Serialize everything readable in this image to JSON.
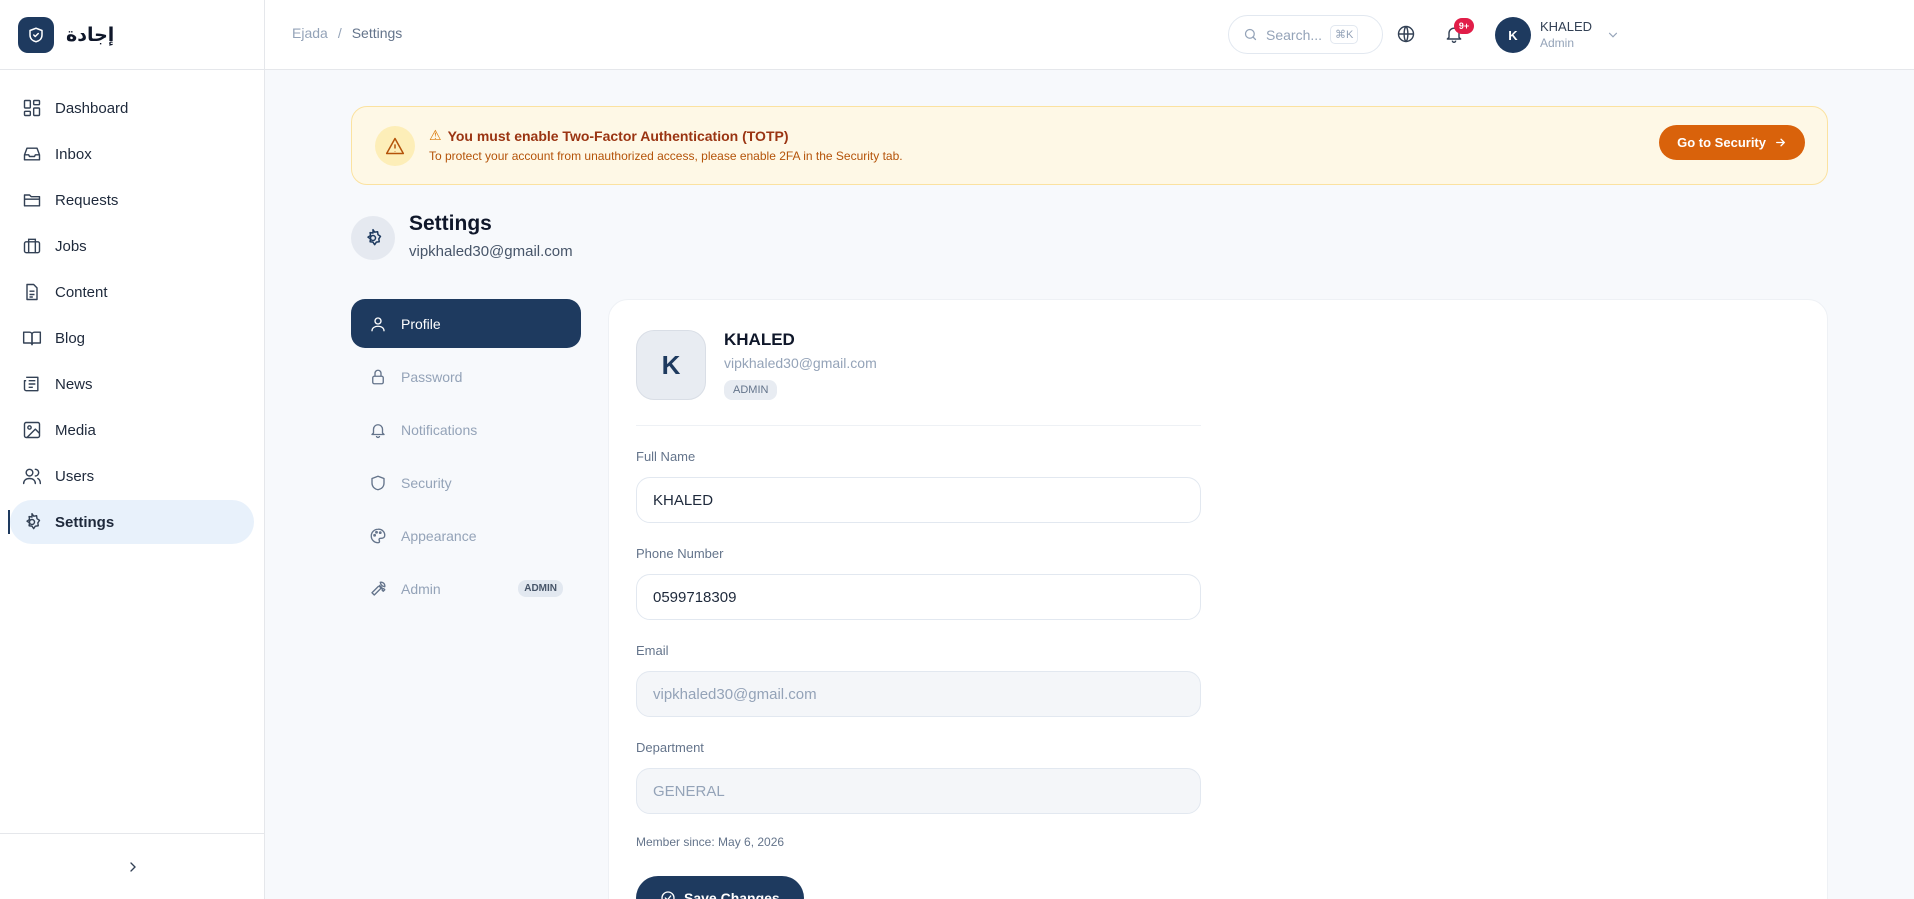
{
  "brand": {
    "name": "إجادة"
  },
  "sidebar": {
    "items": [
      {
        "label": "Dashboard",
        "icon": "dashboard-icon"
      },
      {
        "label": "Inbox",
        "icon": "inbox-icon"
      },
      {
        "label": "Requests",
        "icon": "folder-icon"
      },
      {
        "label": "Jobs",
        "icon": "briefcase-icon"
      },
      {
        "label": "Content",
        "icon": "document-icon"
      },
      {
        "label": "Blog",
        "icon": "book-icon"
      },
      {
        "label": "News",
        "icon": "newspaper-icon"
      },
      {
        "label": "Media",
        "icon": "image-icon"
      },
      {
        "label": "Users",
        "icon": "users-icon"
      },
      {
        "label": "Settings",
        "icon": "gear-icon",
        "active": true
      }
    ]
  },
  "header": {
    "breadcrumb": [
      "Ejada",
      "/",
      "Settings"
    ],
    "search": {
      "placeholder": "Search...",
      "shortcut": "⌘K"
    },
    "notifications_badge": "9+",
    "user": {
      "initial": "K",
      "name": "KHALED",
      "role": "Admin"
    }
  },
  "alert": {
    "title": "You must enable Two-Factor Authentication (TOTP)",
    "description": "To protect your account from unauthorized access, please enable 2FA in the Security tab.",
    "button": "Go to Security"
  },
  "page": {
    "title": "Settings",
    "subtitle": "vipkhaled30@gmail.com"
  },
  "tabs": [
    {
      "label": "Profile",
      "icon": "user-icon",
      "active": true
    },
    {
      "label": "Password",
      "icon": "lock-icon"
    },
    {
      "label": "Notifications",
      "icon": "bell-icon"
    },
    {
      "label": "Security",
      "icon": "shield-icon"
    },
    {
      "label": "Appearance",
      "icon": "palette-icon"
    },
    {
      "label": "Admin",
      "icon": "wrench-icon",
      "badge": "ADMIN"
    }
  ],
  "profile": {
    "initial": "K",
    "name": "KHALED",
    "email": "vipkhaled30@gmail.com",
    "role": "ADMIN",
    "fields": {
      "full_name": {
        "label": "Full Name",
        "value": "KHALED"
      },
      "phone": {
        "label": "Phone Number",
        "value": "0599718309"
      },
      "email": {
        "label": "Email",
        "value": "vipkhaled30@gmail.com"
      },
      "department": {
        "label": "Department",
        "value": "GENERAL"
      }
    },
    "member_since": "Member since: May 6, 2026",
    "save_label": "Save Changes"
  },
  "colors": {
    "primary": "#1e3a5f",
    "warning_bg": "#fef8e6",
    "warning_button": "#d9620b",
    "badge_red": "#e11d48"
  }
}
